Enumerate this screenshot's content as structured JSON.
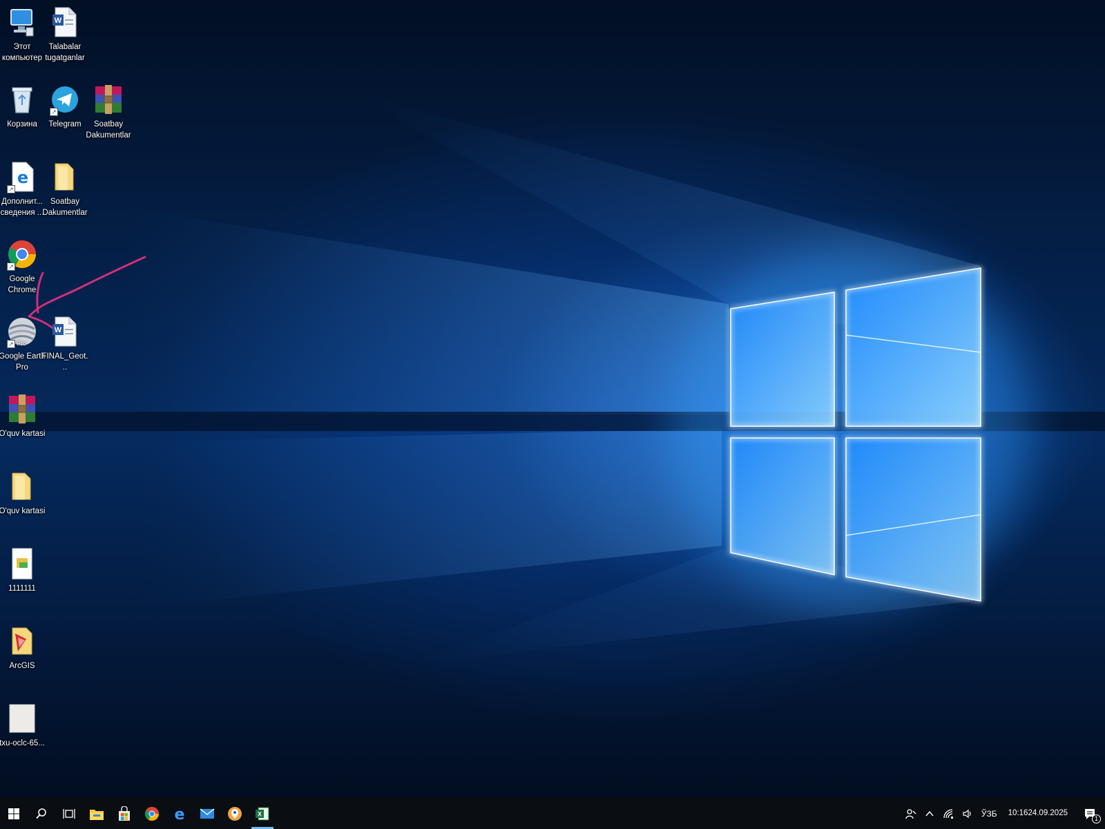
{
  "desktop": {
    "icons": [
      {
        "id": "this-pc",
        "label": "Этот компьютер",
        "icon": "computer-icon"
      },
      {
        "id": "talabalar",
        "label": "Talabalar tugatganlar",
        "icon": "word-document-icon"
      },
      {
        "id": "recycle-bin",
        "label": "Корзина",
        "icon": "recycle-bin-icon"
      },
      {
        "id": "telegram",
        "label": "Telegram",
        "icon": "telegram-icon"
      },
      {
        "id": "soatbay-rar",
        "label": "Soatbay Dakumentlar",
        "icon": "winrar-archive-icon"
      },
      {
        "id": "dop-svedeniya",
        "label": "Дополнит... сведения ...",
        "icon": "edge-shortcut-icon"
      },
      {
        "id": "soatbay-folder",
        "label": "Soatbay Dakumentlar",
        "icon": "folder-icon"
      },
      {
        "id": "google-chrome",
        "label": "Google Chrome",
        "icon": "chrome-icon"
      },
      {
        "id": "google-earth",
        "label": "Google Earth Pro",
        "icon": "google-earth-icon",
        "badge": "Pro"
      },
      {
        "id": "final-geot",
        "label": "FINAL_Geot...",
        "icon": "word-document-icon"
      },
      {
        "id": "oquv-rar",
        "label": "O'quv kartasi",
        "icon": "winrar-archive-icon"
      },
      {
        "id": "oquv-folder",
        "label": "O'quv kartasi",
        "icon": "folder-icon"
      },
      {
        "id": "1111111",
        "label": "1111111",
        "icon": "image-file-icon"
      },
      {
        "id": "arcgis",
        "label": "ArcGIS",
        "icon": "arcgis-icon"
      },
      {
        "id": "txu",
        "label": "txu-oclc-65...",
        "icon": "blank-file-icon"
      }
    ]
  },
  "annotation": {
    "color": "#d0307a"
  },
  "taskbar": {
    "apps": [
      {
        "id": "start",
        "icon": "windows-logo-icon"
      },
      {
        "id": "search",
        "icon": "search-icon"
      },
      {
        "id": "task-view",
        "icon": "task-view-icon"
      },
      {
        "id": "file-explorer",
        "icon": "file-explorer-icon"
      },
      {
        "id": "store",
        "icon": "store-icon"
      },
      {
        "id": "chrome",
        "icon": "chrome-icon"
      },
      {
        "id": "edge",
        "icon": "edge-icon"
      },
      {
        "id": "mail",
        "icon": "mail-icon"
      },
      {
        "id": "maps",
        "icon": "location-pin-icon"
      },
      {
        "id": "excel",
        "icon": "excel-icon",
        "active": true
      }
    ],
    "tray": {
      "language": "ЎЗБ",
      "time": "10:16",
      "date": "24.09.2025",
      "notification_count": "1"
    }
  },
  "colors": {
    "accent": "#0078d7",
    "taskbar_bg": "#0a0d12"
  }
}
